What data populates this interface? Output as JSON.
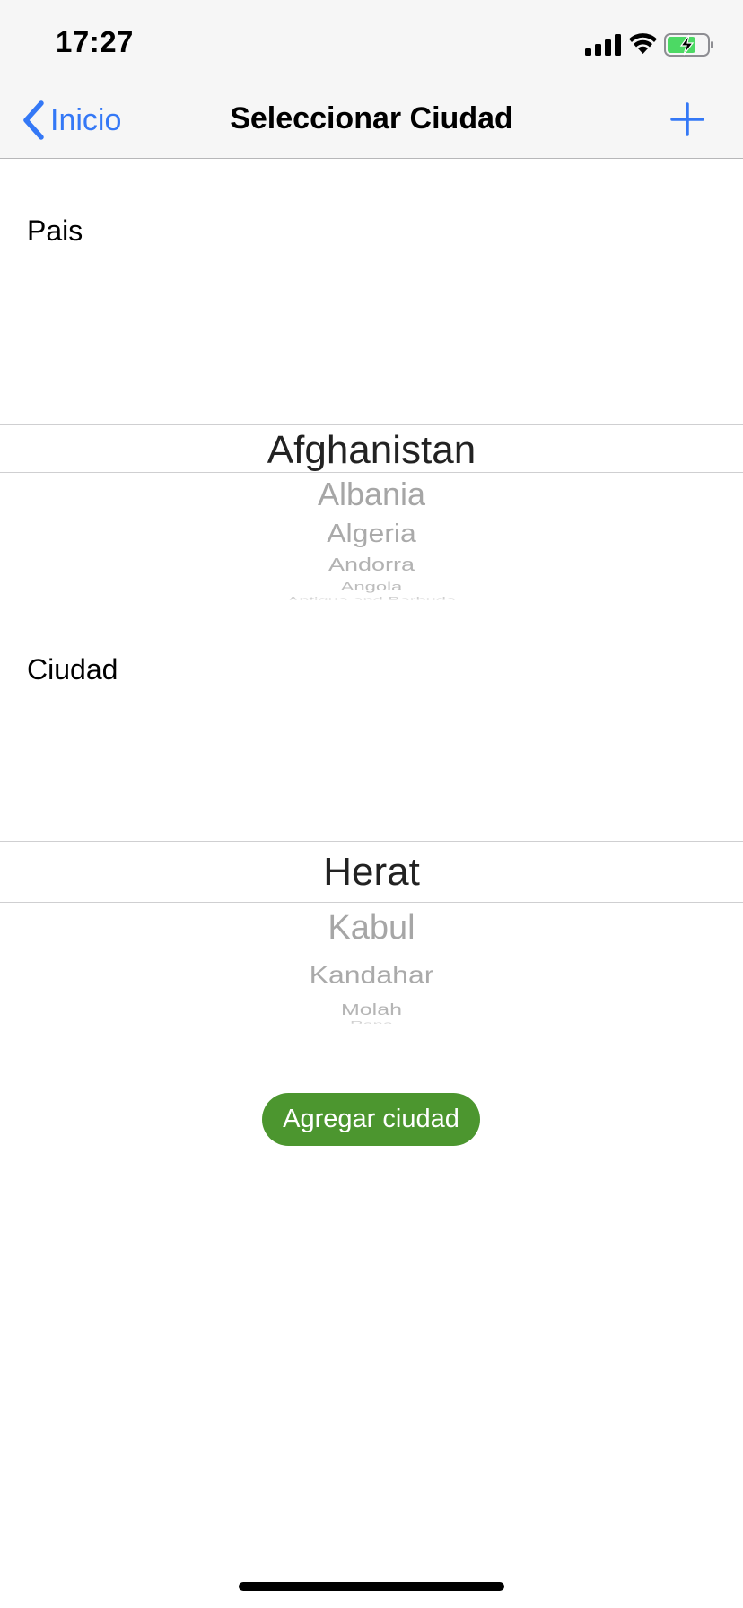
{
  "status_bar": {
    "time": "17:27",
    "icons": [
      "cellular-signal-icon",
      "wifi-icon",
      "battery-charging-icon"
    ],
    "battery_color": "#4cd964"
  },
  "nav": {
    "back_label": "Inicio",
    "title": "Seleccionar Ciudad",
    "add_icon": "plus-icon",
    "accent_color": "#3478f6"
  },
  "pais": {
    "label": "Pais",
    "selected": "Afghanistan",
    "below": [
      "Albania",
      "Algeria",
      "Andorra",
      "Angola",
      "Antigua and Barbuda"
    ]
  },
  "ciudad": {
    "label": "Ciudad",
    "selected": "Herat",
    "below": [
      "Kabul",
      "Kandahar",
      "Molah",
      "Rana"
    ]
  },
  "agregar_button": {
    "label": "Agregar ciudad",
    "color": "#4c962f"
  }
}
